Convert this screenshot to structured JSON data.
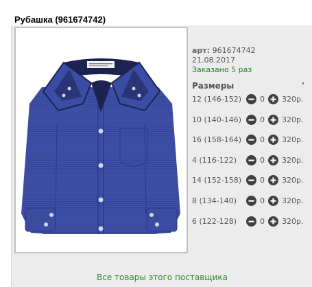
{
  "product": {
    "title": "Рубашка (961674742)",
    "article_label": "арт:",
    "article_value": "961674742",
    "date": "21.08.2017",
    "ordered": "Заказано 5 раз",
    "image_icon": "shirt-photo"
  },
  "sizes": {
    "heading": "Размеры",
    "items": [
      {
        "label": "12 (146-152)",
        "qty": "0",
        "price": "320р."
      },
      {
        "label": "10 (140-146)",
        "qty": "0",
        "price": "320р."
      },
      {
        "label": "16 (158-164)",
        "qty": "0",
        "price": "320р."
      },
      {
        "label": "4 (116-122)",
        "qty": "0",
        "price": "320р."
      },
      {
        "label": "14 (152-158)",
        "qty": "0",
        "price": "320р."
      },
      {
        "label": "8 (134-140)",
        "qty": "0",
        "price": "320р."
      },
      {
        "label": "6 (122-128)",
        "qty": "0",
        "price": "320р."
      }
    ]
  },
  "footer": {
    "supplier_link": "Все товары этого поставщика"
  },
  "colors": {
    "ordered_green": "#1f7f1f",
    "link_green": "#2e8b2e",
    "button_dark": "#404040",
    "shirt_blue": "#3d4fa8"
  }
}
